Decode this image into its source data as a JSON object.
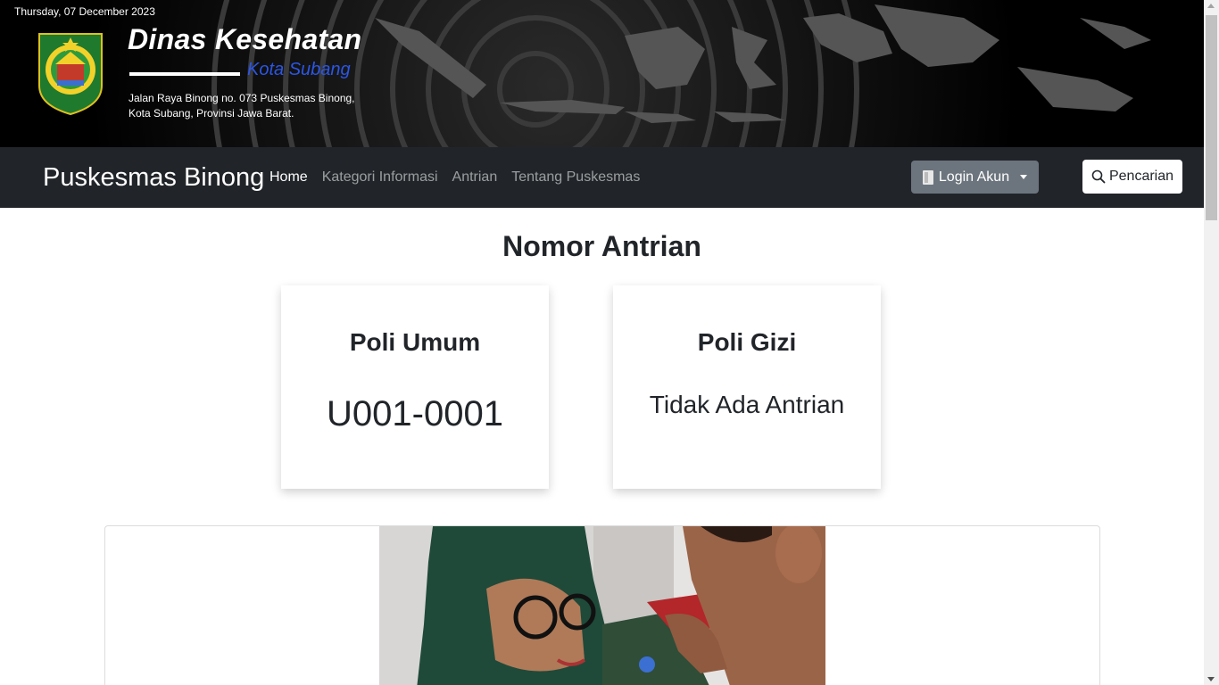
{
  "header": {
    "date": "Thursday, 07 December 2023",
    "title": "Dinas Kesehatan",
    "subtitle": "Kota Subang",
    "address_line1": "Jalan Raya Binong no. 073 Puskesmas Binong,",
    "address_line2": "Kota Subang, Provinsi Jawa Barat.",
    "logo_icon": "subang-regency-emblem-icon"
  },
  "navbar": {
    "brand": "Puskesmas Binong",
    "links": [
      {
        "label": "Home",
        "active": true
      },
      {
        "label": "Kategori Informasi",
        "active": false
      },
      {
        "label": "Antrian",
        "active": false
      },
      {
        "label": "Tentang Puskesmas",
        "active": false
      }
    ],
    "login_label": "Login Akun",
    "search_label": "Pencarian"
  },
  "queue": {
    "title": "Nomor Antrian",
    "cards": [
      {
        "name": "Poli Umum",
        "value": "U001-0001"
      },
      {
        "name": "Poli Gizi",
        "value": "Tidak Ada Antrian"
      }
    ]
  },
  "colors": {
    "navbar": "#212529",
    "login_button": "#6c757d",
    "subtitle": "#2b56e6"
  }
}
